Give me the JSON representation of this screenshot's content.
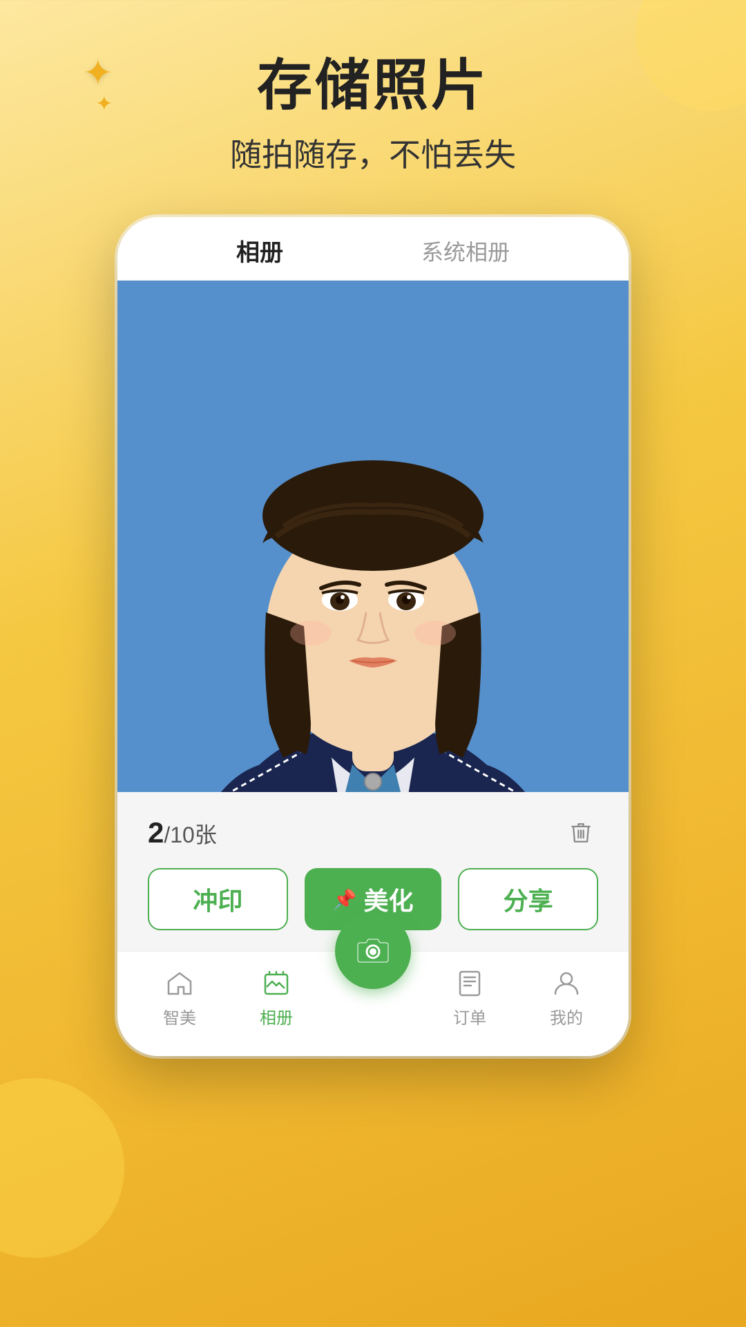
{
  "background": {
    "gradient_start": "#fde8a0",
    "gradient_end": "#e8a820"
  },
  "header": {
    "main_title": "存储照片",
    "subtitle": "随拍随存，不怕丢失",
    "star_large": "✦",
    "star_small": "✦"
  },
  "phone": {
    "tab_album": "相册",
    "tab_system": "系统相册",
    "photo_counter": {
      "current": "2",
      "slash": "/",
      "total": "10",
      "unit": "张"
    },
    "buttons": {
      "print": "冲印",
      "beautify": "美化",
      "share": "分享"
    },
    "nav": {
      "items": [
        {
          "label": "智美",
          "active": false,
          "icon": "home-icon"
        },
        {
          "label": "相册",
          "active": true,
          "icon": "album-icon"
        },
        {
          "label": "",
          "active": false,
          "icon": "camera-fab-icon"
        },
        {
          "label": "订单",
          "active": false,
          "icon": "order-icon"
        },
        {
          "label": "我的",
          "active": false,
          "icon": "profile-icon"
        }
      ]
    }
  }
}
